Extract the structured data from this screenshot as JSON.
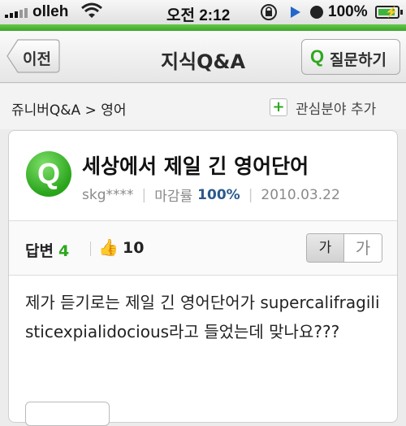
{
  "status_bar": {
    "carrier": "olleh",
    "time": "오전 2:12",
    "battery_percent": "100%",
    "icons": [
      "signal-icon",
      "wifi-icon",
      "rotation-lock-icon",
      "play-icon",
      "alarm-icon",
      "battery-icon"
    ]
  },
  "navbar": {
    "back_label": "이전",
    "title": "지식Q&A",
    "ask_icon": "Q",
    "ask_label": "질문하기"
  },
  "breadcrumb": {
    "path": "쥬니버Q&A > 영어",
    "add_interest_label": "관심분야 추가"
  },
  "question": {
    "avatar_letter": "Q",
    "title": "세상에서 제일 긴 영어단어",
    "author": "skg****",
    "deadline_label": "마감률",
    "deadline_rate": "100%",
    "date": "2010.03.22"
  },
  "answers": {
    "label": "답변",
    "count": "4",
    "likes": "10",
    "font_small": "가",
    "font_large": "가"
  },
  "body": {
    "text": "제가 듣기로는 제일 긴 영어단어가 supercalifragilisticexpialidocious라고 들었는데 맞나요???"
  },
  "colors": {
    "accent_green": "#2ea81f",
    "rate_blue": "#2b5a8c"
  }
}
